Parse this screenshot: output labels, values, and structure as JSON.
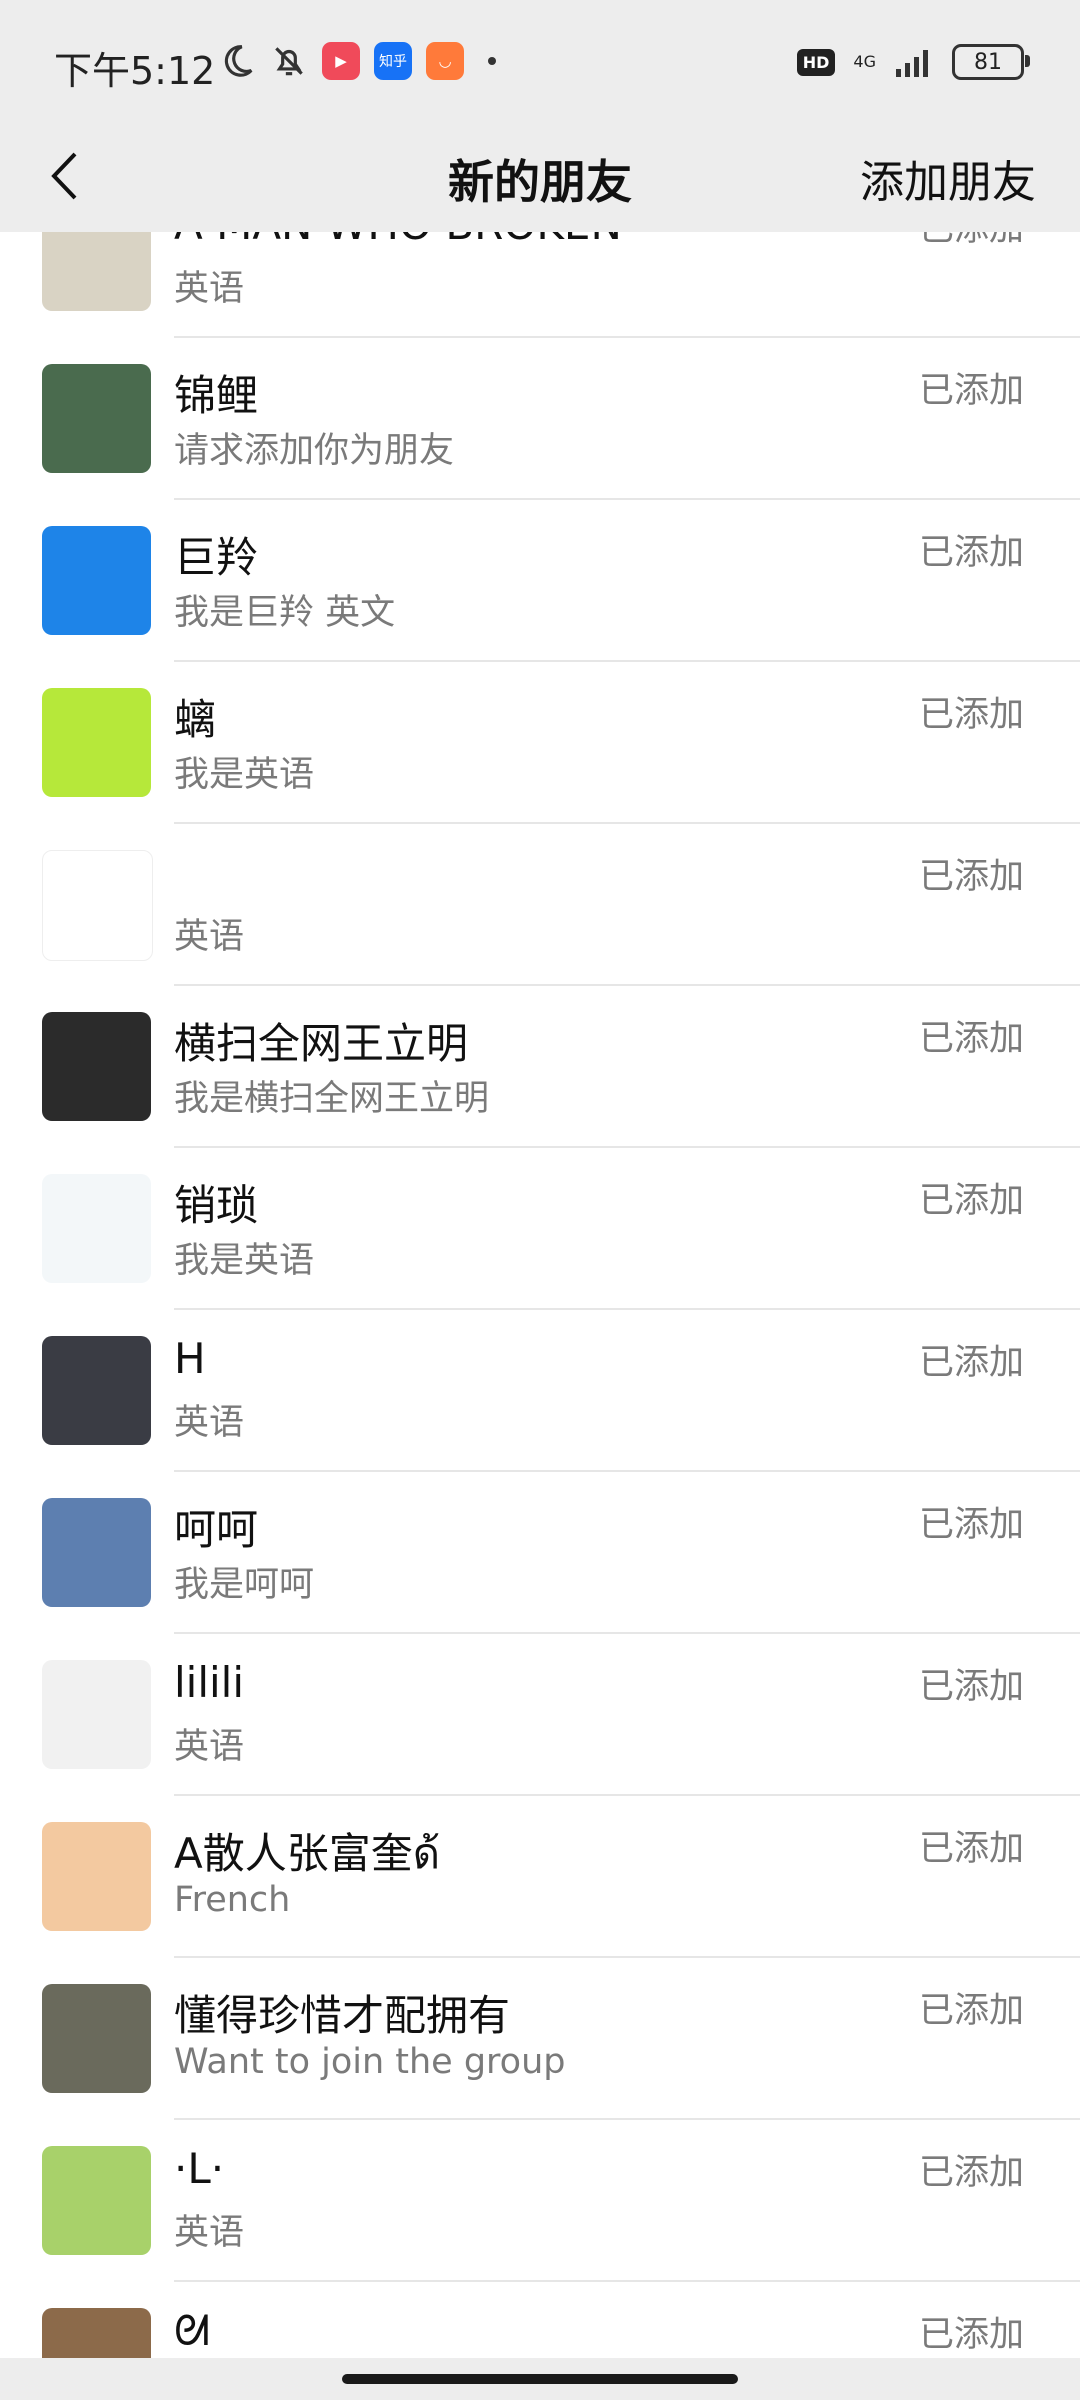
{
  "status_bar": {
    "time": "下午5:12",
    "app_icons": [
      "moon-icon",
      "bell-off-icon",
      "video-app-icon",
      "zhihu-app-icon",
      "shop-app-icon"
    ],
    "zhihu_label": "知乎",
    "hd_label": "HD",
    "network": "4G",
    "battery": "81"
  },
  "header": {
    "title": "新的朋友",
    "action": "添加朋友"
  },
  "friends": [
    {
      "name": "A MAN WHO BROKEN",
      "message": "英语",
      "status": "已添加",
      "avatar_color": "#d9d3c4"
    },
    {
      "name": "锦鲤",
      "message": "请求添加你为朋友",
      "status": "已添加",
      "avatar_color": "#4a6b4e"
    },
    {
      "name": "巨羚",
      "message": "我是巨羚  英文",
      "status": "已添加",
      "avatar_color": "#1e84e8"
    },
    {
      "name": "螭",
      "message": "我是英语",
      "status": "已添加",
      "avatar_color": "#b6e83a"
    },
    {
      "name": "",
      "message": "英语",
      "status": "已添加",
      "avatar_color": "#ffffff"
    },
    {
      "name": "横扫全网王立明",
      "message": "我是横扫全网王立明",
      "status": "已添加",
      "avatar_color": "#2b2b2b"
    },
    {
      "name": "销琐",
      "message": "我是英语",
      "status": "已添加",
      "avatar_color": "#f3f7f9"
    },
    {
      "name": "H",
      "message": "英语",
      "status": "已添加",
      "avatar_color": "#3a3c44"
    },
    {
      "name": "呵呵",
      "message": "我是呵呵",
      "status": "已添加",
      "avatar_color": "#5d7fb0"
    },
    {
      "name": "lilili",
      "message": "英语",
      "status": "已添加",
      "avatar_color": "#f1f1f1"
    },
    {
      "name": "A散人张富奎ด้",
      "message": "French",
      "status": "已添加",
      "avatar_color": "#f3c9a0"
    },
    {
      "name": "懂得珍惜才配拥有",
      "message": "Want to join the group",
      "status": "已添加",
      "avatar_color": "#6a6a5c"
    },
    {
      "name": "·L·",
      "message": "英语",
      "status": "已添加",
      "avatar_color": "#a8d16a"
    },
    {
      "name": "ᘛ",
      "message": "",
      "status": "已添加",
      "avatar_color": "#8c6a4a"
    }
  ]
}
